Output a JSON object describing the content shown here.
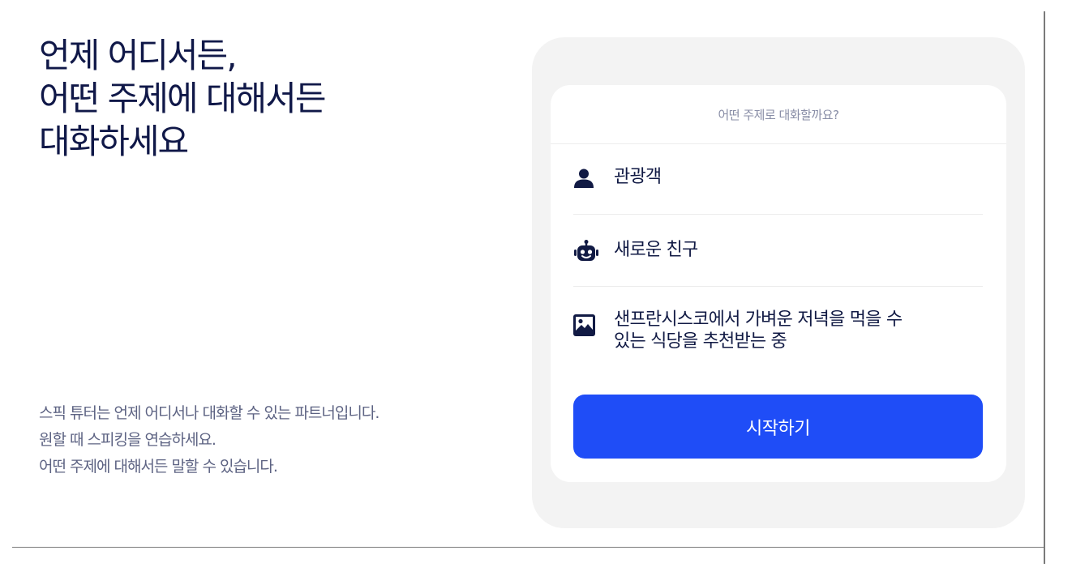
{
  "hero": {
    "headline_lines": [
      "언제 어디서든,",
      "어떤 주제에 대해서든",
      "대화하세요"
    ],
    "description_lines": [
      "스픽 튜터는 언제 어디서나 대화할 수 있는 파트너입니다.",
      "원할 때 스피킹을 연습하세요.",
      "어떤 주제에 대해서든 말할 수 있습니다."
    ]
  },
  "card": {
    "question": "어떤 주제로 대화할까요?",
    "options": [
      {
        "icon": "user-icon",
        "label": "관광객"
      },
      {
        "icon": "robot-icon",
        "label": "새로운 친구"
      },
      {
        "icon": "image-icon",
        "label_lines": [
          "샌프란시스코에서 가벼운 저녁을 먹을 수",
          "있는 식당을 추천받는 중"
        ]
      }
    ],
    "start_label": "시작하기"
  },
  "colors": {
    "accent": "#1f4df7",
    "headline": "#101848",
    "body": "#5d6383",
    "panel_bg": "#f3f3f3"
  }
}
